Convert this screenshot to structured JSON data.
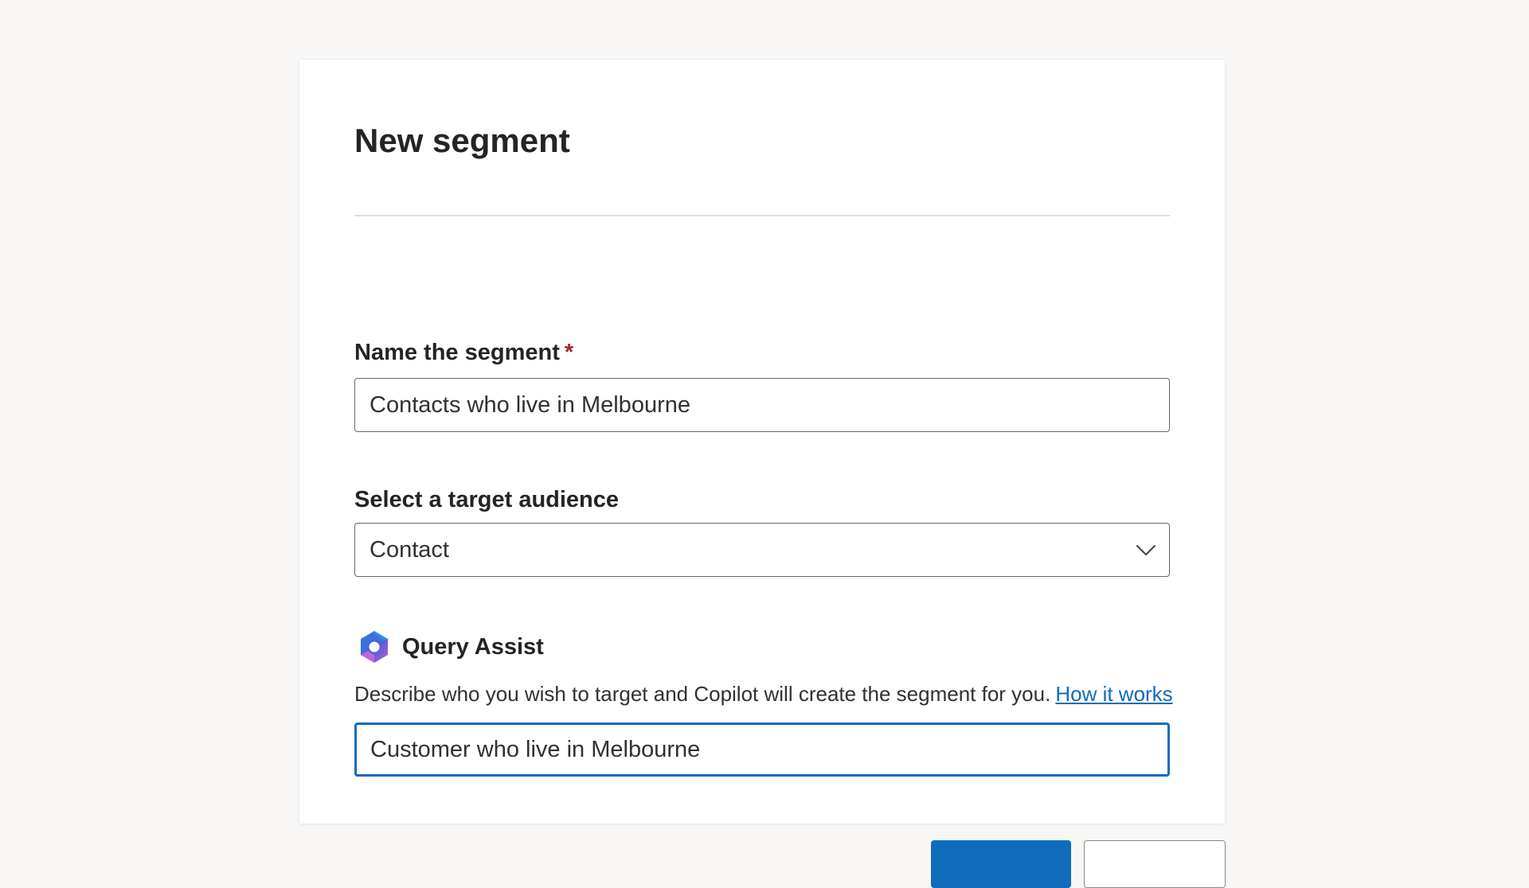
{
  "dialog": {
    "title": "New segment"
  },
  "segment_name": {
    "label": "Name the segment",
    "required_marker": "*",
    "value": "Contacts who live in Melbourne"
  },
  "target_audience": {
    "label": "Select a target audience",
    "selected": "Contact",
    "icon": "chevron-down-icon"
  },
  "query_assist": {
    "title": "Query Assist",
    "icon": "copilot-icon",
    "description": "Describe who you wish to target and Copilot will create the segment for you.",
    "link_label": "How it works",
    "input_value": "Customer who live in Melbourne"
  },
  "colors": {
    "accent": "#0f6cbd",
    "required": "#a4262c",
    "background": "#f8f7f6"
  }
}
